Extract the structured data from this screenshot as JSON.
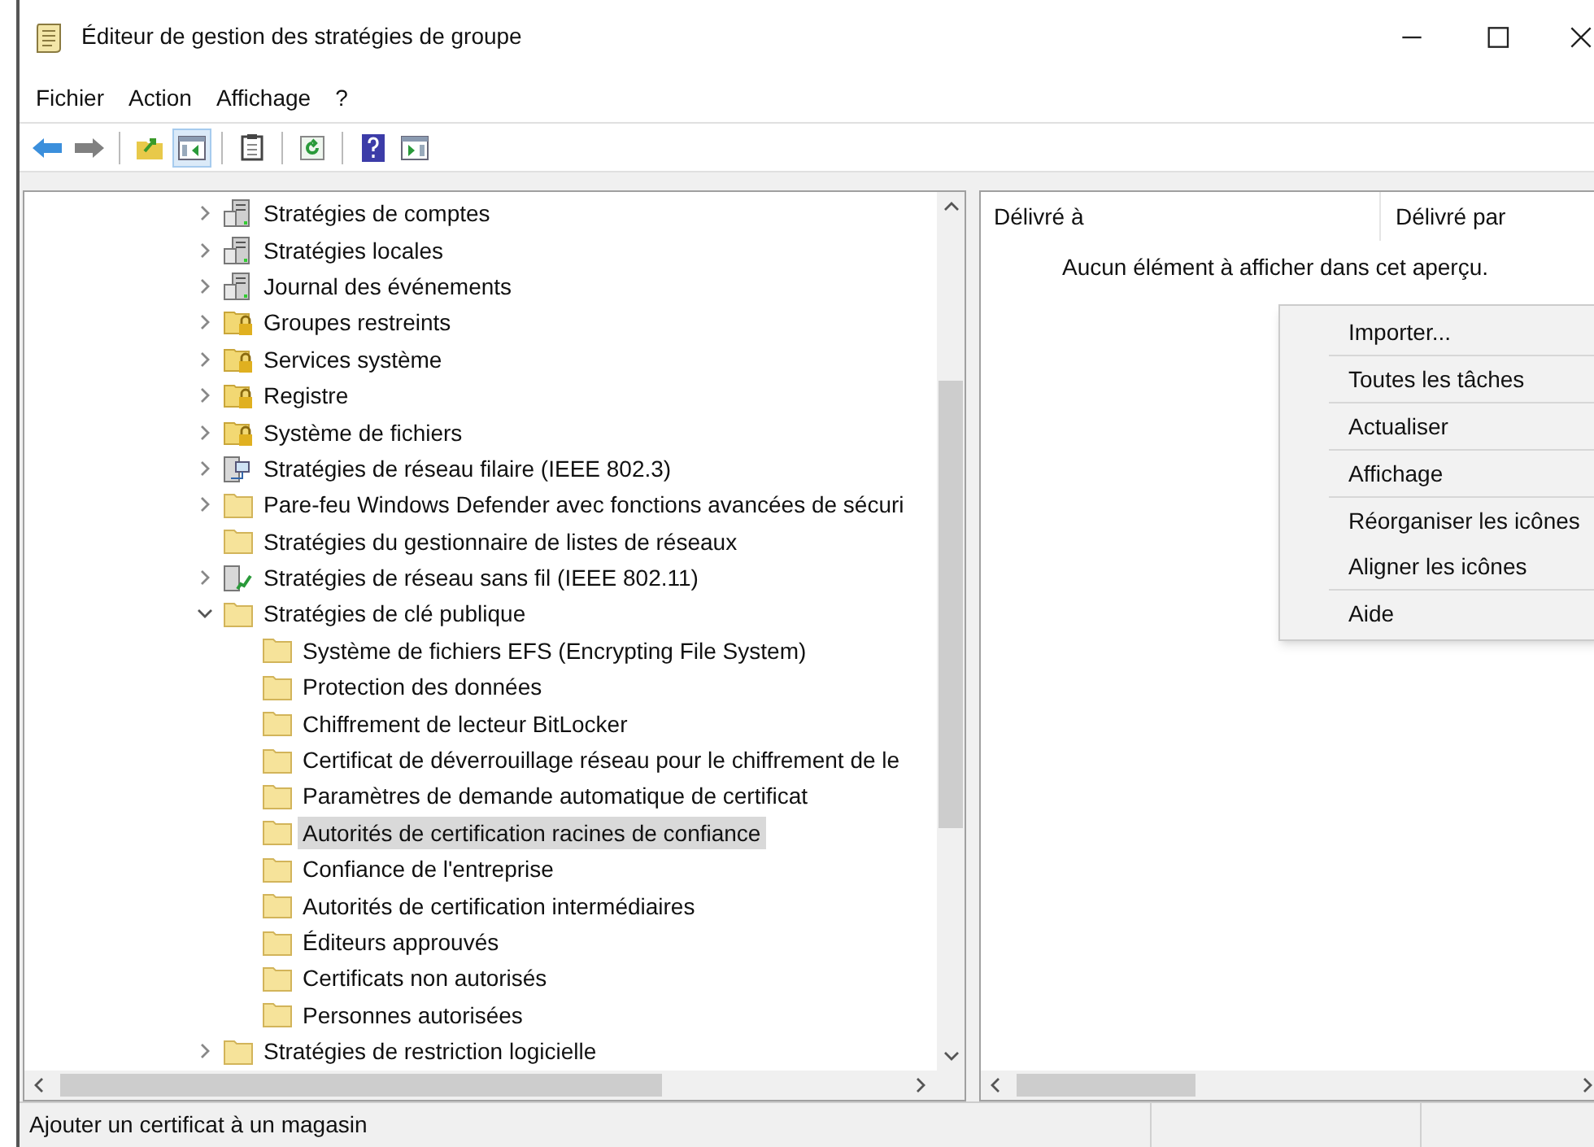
{
  "window": {
    "title": "Éditeur de gestion des stratégies de groupe"
  },
  "menu": [
    "Fichier",
    "Action",
    "Affichage",
    "?"
  ],
  "toolbar": [
    {
      "kind": "back",
      "selected": false
    },
    {
      "kind": "forward",
      "selected": false
    },
    {
      "kind": "sep"
    },
    {
      "kind": "up",
      "selected": false
    },
    {
      "kind": "tree",
      "selected": true
    },
    {
      "kind": "sep"
    },
    {
      "kind": "clipboard",
      "selected": false
    },
    {
      "kind": "sep"
    },
    {
      "kind": "refresh",
      "selected": false
    },
    {
      "kind": "sep"
    },
    {
      "kind": "help",
      "selected": false
    },
    {
      "kind": "pane",
      "selected": false
    }
  ],
  "tree": [
    {
      "label": "Stratégies de comptes",
      "kind": "policy",
      "expanded": false,
      "selected": false
    },
    {
      "label": "Stratégies locales",
      "kind": "policy",
      "expanded": false,
      "selected": false
    },
    {
      "label": "Journal des événements",
      "kind": "policy",
      "expanded": false,
      "selected": false
    },
    {
      "label": "Groupes restreints",
      "kind": "lock",
      "expanded": false,
      "selected": false
    },
    {
      "label": "Services système",
      "kind": "lock",
      "expanded": false,
      "selected": false
    },
    {
      "label": "Registre",
      "kind": "lock",
      "expanded": false,
      "selected": false
    },
    {
      "label": "Système de fichiers",
      "kind": "lock",
      "expanded": false,
      "selected": false
    },
    {
      "label": "Stratégies de réseau filaire (IEEE 802.3)",
      "kind": "network",
      "expanded": false,
      "selected": false
    },
    {
      "label": "Pare-feu Windows Defender avec fonctions avancées de sécuri",
      "kind": "folder",
      "expanded": false,
      "selected": false
    },
    {
      "label": "Stratégies du gestionnaire de listes de réseaux",
      "kind": "folder",
      "selected": false
    },
    {
      "label": "Stratégies de réseau sans fil (IEEE 802.11)",
      "kind": "wireless",
      "expanded": false,
      "selected": false
    },
    {
      "label": "Stratégies de clé publique",
      "kind": "folder",
      "expanded": true,
      "selected": false,
      "children": [
        {
          "label": "Système de fichiers EFS (Encrypting File System)",
          "kind": "folder",
          "selected": false
        },
        {
          "label": "Protection des données",
          "kind": "folder",
          "selected": false
        },
        {
          "label": "Chiffrement de lecteur BitLocker",
          "kind": "folder",
          "selected": false
        },
        {
          "label": "Certificat de déverrouillage réseau pour le chiffrement de le",
          "kind": "folder",
          "selected": false
        },
        {
          "label": "Paramètres de demande automatique de certificat",
          "kind": "folder",
          "selected": false
        },
        {
          "label": "Autorités de certification racines de confiance",
          "kind": "folder",
          "selected": true
        },
        {
          "label": "Confiance de l'entreprise",
          "kind": "folder",
          "selected": false
        },
        {
          "label": "Autorités de certification intermédiaires",
          "kind": "folder",
          "selected": false
        },
        {
          "label": "Éditeurs approuvés",
          "kind": "folder",
          "selected": false
        },
        {
          "label": "Certificats non autorisés",
          "kind": "folder",
          "selected": false
        },
        {
          "label": "Personnes autorisées",
          "kind": "folder",
          "selected": false
        }
      ]
    },
    {
      "label": "Stratégies de restriction logicielle",
      "kind": "folder",
      "expanded": false,
      "selected": false
    }
  ],
  "list": {
    "columns": [
      "Délivré à",
      "Délivré par"
    ],
    "empty_text": "Aucun élément à afficher dans cet aperçu."
  },
  "context_menu": [
    [
      "Importer..."
    ],
    [
      "Toutes les tâches"
    ],
    [
      "Actualiser"
    ],
    [
      "Affichage"
    ],
    [
      "Réorganiser les icônes",
      "Aligner les icônes"
    ],
    [
      "Aide"
    ]
  ],
  "status_bar": {
    "text": "Ajouter un certificat à un magasin"
  }
}
